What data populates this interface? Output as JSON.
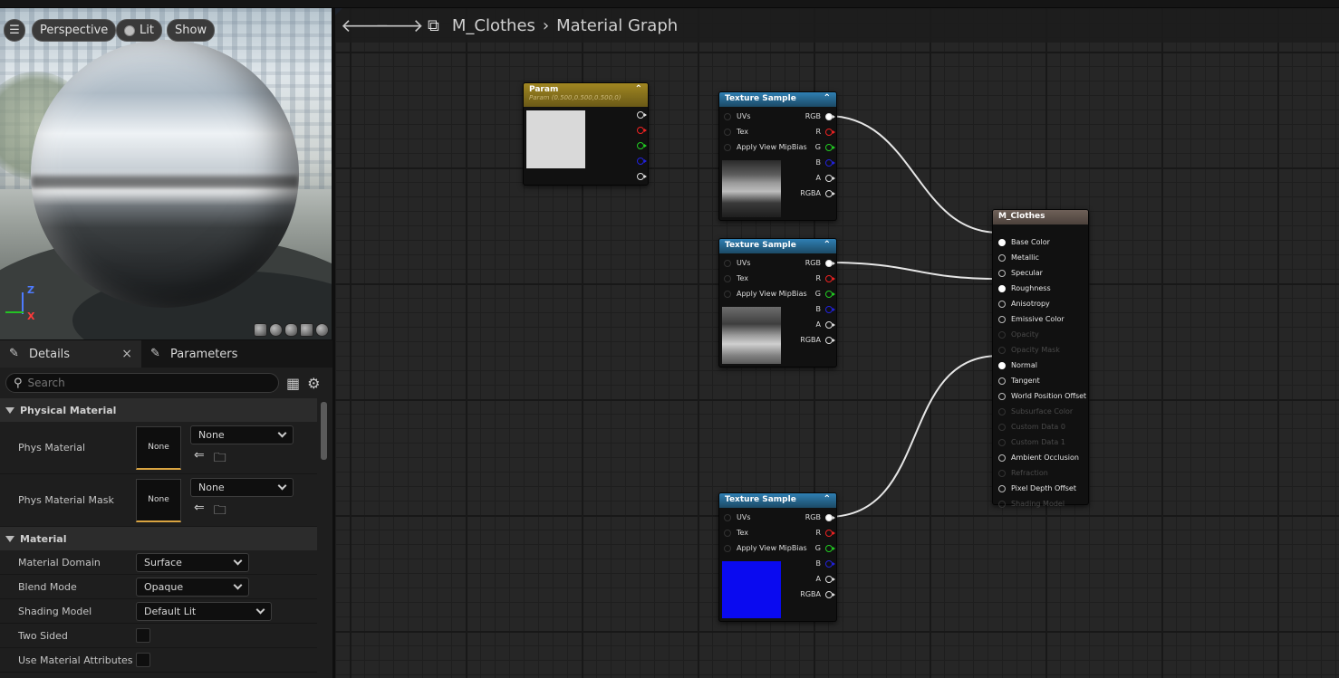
{
  "viewport": {
    "menu_icon": "hamburger-icon",
    "perspective_label": "Perspective",
    "lit_label": "Lit",
    "show_label": "Show",
    "axis_z": "Z",
    "axis_x": "X"
  },
  "details": {
    "tab_details": "Details",
    "tab_parameters": "Parameters",
    "close_glyph": "×",
    "search_placeholder": "Search",
    "categories": {
      "physical": "Physical Material",
      "material": "Material"
    },
    "props": {
      "phys_material": {
        "label": "Phys Material",
        "thumb": "None",
        "value": "None"
      },
      "phys_material_mask": {
        "label": "Phys Material Mask",
        "thumb": "None",
        "value": "None"
      },
      "material_domain": {
        "label": "Material Domain",
        "value": "Surface"
      },
      "blend_mode": {
        "label": "Blend Mode",
        "value": "Opaque"
      },
      "shading_model": {
        "label": "Shading Model",
        "value": "Default Lit"
      },
      "two_sided": {
        "label": "Two Sided",
        "checked": false
      },
      "use_material_attributes": {
        "label": "Use Material Attributes",
        "checked": false
      }
    }
  },
  "graph": {
    "breadcrumb_asset": "M_Clothes",
    "breadcrumb_page": "Material Graph",
    "param_node": {
      "title": "Param",
      "subtitle": "Param (0.500,0.500,0.500,0)"
    },
    "texture_sample_title": "Texture Sample",
    "tex_inputs": [
      "UVs",
      "Tex",
      "Apply View MipBias"
    ],
    "tex_outputs": [
      "RGB",
      "R",
      "G",
      "B",
      "A",
      "RGBA"
    ],
    "result_node": {
      "title": "M_Clothes",
      "pins": [
        {
          "label": "Base Color",
          "active": true,
          "connected": true
        },
        {
          "label": "Metallic",
          "active": true,
          "connected": false
        },
        {
          "label": "Specular",
          "active": true,
          "connected": false
        },
        {
          "label": "Roughness",
          "active": true,
          "connected": true
        },
        {
          "label": "Anisotropy",
          "active": true,
          "connected": false
        },
        {
          "label": "Emissive Color",
          "active": true,
          "connected": false
        },
        {
          "label": "Opacity",
          "active": false,
          "connected": false
        },
        {
          "label": "Opacity Mask",
          "active": false,
          "connected": false
        },
        {
          "label": "Normal",
          "active": true,
          "connected": true
        },
        {
          "label": "Tangent",
          "active": true,
          "connected": false
        },
        {
          "label": "World Position Offset",
          "active": true,
          "connected": false
        },
        {
          "label": "Subsurface Color",
          "active": false,
          "connected": false
        },
        {
          "label": "Custom Data 0",
          "active": false,
          "connected": false
        },
        {
          "label": "Custom Data 1",
          "active": false,
          "connected": false
        },
        {
          "label": "Ambient Occlusion",
          "active": true,
          "connected": false
        },
        {
          "label": "Refraction",
          "active": false,
          "connected": false
        },
        {
          "label": "Pixel Depth Offset",
          "active": true,
          "connected": false
        },
        {
          "label": "Shading Model",
          "active": false,
          "connected": false
        }
      ]
    }
  }
}
